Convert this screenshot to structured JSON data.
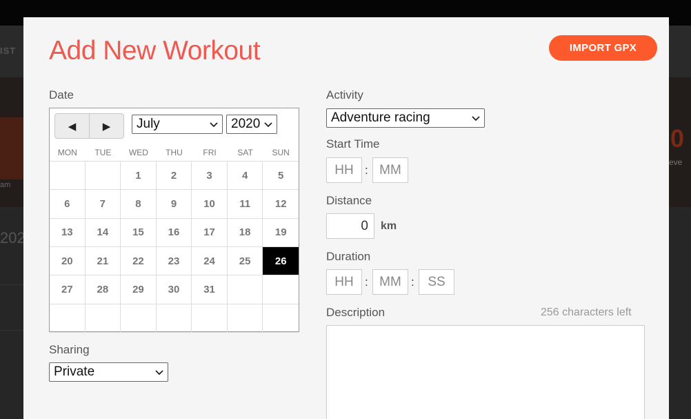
{
  "background": {
    "nav_fragment": "IST",
    "hero_left_fragment": "am",
    "hero_right_number": "0",
    "hero_right_fragment": "eve",
    "year_fragment": "202"
  },
  "modal": {
    "title": "Add New Workout",
    "import_button": "IMPORT GPX"
  },
  "date": {
    "label": "Date",
    "prev_icon": "◀",
    "next_icon": "▶",
    "month": "July",
    "year": "2020",
    "weekdays": [
      "MON",
      "TUE",
      "WED",
      "THU",
      "FRI",
      "SAT",
      "SUN"
    ],
    "days": [
      "",
      "",
      "1",
      "2",
      "3",
      "4",
      "5",
      "6",
      "7",
      "8",
      "9",
      "10",
      "11",
      "12",
      "13",
      "14",
      "15",
      "16",
      "17",
      "18",
      "19",
      "20",
      "21",
      "22",
      "23",
      "24",
      "25",
      "26",
      "27",
      "28",
      "29",
      "30",
      "31",
      "",
      "",
      "",
      "",
      "",
      "",
      "",
      "",
      ""
    ],
    "selected_day": "26"
  },
  "sharing": {
    "label": "Sharing",
    "value": "Private"
  },
  "activity": {
    "label": "Activity",
    "value": "Adventure racing"
  },
  "start_time": {
    "label": "Start Time",
    "hh_placeholder": "HH",
    "mm_placeholder": "MM",
    "separator": ":"
  },
  "distance": {
    "label": "Distance",
    "value": "0",
    "unit": "km"
  },
  "duration": {
    "label": "Duration",
    "hh_placeholder": "HH",
    "mm_placeholder": "MM",
    "ss_placeholder": "SS",
    "separator": ":"
  },
  "description": {
    "label": "Description",
    "chars_left": "256 characters left",
    "value": ""
  },
  "colors": {
    "title": "#ee5a50",
    "import_button": "#fc5a2c",
    "selected_day": "#000000"
  }
}
